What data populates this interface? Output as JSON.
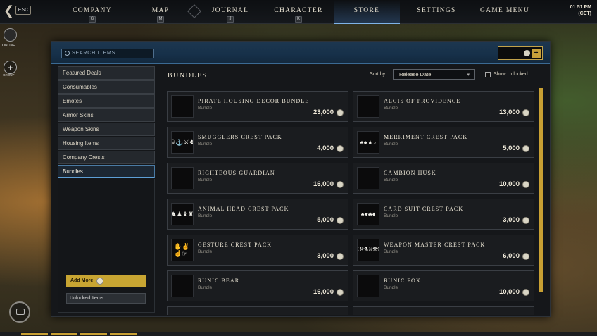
{
  "topbar": {
    "esc_label": "ESC",
    "nav": [
      {
        "label": "COMPANY",
        "key": "G"
      },
      {
        "label": "MAP",
        "key": "M"
      },
      {
        "label": "JOURNAL",
        "key": "J"
      },
      {
        "label": "CHARACTER",
        "key": "K"
      },
      {
        "label": "STORE",
        "key": ""
      },
      {
        "label": "SETTINGS",
        "key": ""
      },
      {
        "label": "GAME MENU",
        "key": ""
      }
    ],
    "clock_time": "01:51 PM",
    "clock_zone": "(CET)"
  },
  "rail": {
    "status": "ONLINE",
    "group": "GROUP"
  },
  "store": {
    "search_placeholder": "SEARCH ITEMS",
    "coin_balance": "0",
    "categories": [
      "Featured Deals",
      "Consumables",
      "Emotes",
      "Armor Skins",
      "Weapon Skins",
      "Housing Items",
      "Company Crests",
      "Bundles"
    ],
    "active_category": "Bundles",
    "add_more_label": "Add More",
    "unlocked_items_label": "Unlocked Items",
    "section_title": "BUNDLES",
    "sort_label": "Sort by :",
    "sort_value": "Release Date",
    "show_unlocked_label": "Show Unlocked",
    "items": [
      {
        "name": "PIRATE HOUSING DECOR BUNDLE",
        "type": "Bundle",
        "price": "23,000",
        "thumb": "gold-treasure-icon"
      },
      {
        "name": "AEGIS OF PROVIDENCE",
        "type": "Bundle",
        "price": "13,000",
        "thumb": "golden-helm-icon"
      },
      {
        "name": "SMUGGLERS CREST PACK",
        "type": "Bundle",
        "price": "4,000",
        "thumb": "smuggler-crests-icon"
      },
      {
        "name": "MERRIMENT CREST PACK",
        "type": "Bundle",
        "price": "5,000",
        "thumb": "merriment-crests-icon"
      },
      {
        "name": "RIGHTEOUS GUARDIAN",
        "type": "Bundle",
        "price": "16,000",
        "thumb": "steel-knight-icon"
      },
      {
        "name": "CAMBION HUSK",
        "type": "Bundle",
        "price": "10,000",
        "thumb": "horned-helm-icon"
      },
      {
        "name": "ANIMAL HEAD CREST PACK",
        "type": "Bundle",
        "price": "5,000",
        "thumb": "animal-crests-icon"
      },
      {
        "name": "CARD SUIT CREST PACK",
        "type": "Bundle",
        "price": "3,000",
        "thumb": "card-suit-crests-icon"
      },
      {
        "name": "GESTURE CREST PACK",
        "type": "Bundle",
        "price": "3,000",
        "thumb": "gesture-crests-icon"
      },
      {
        "name": "WEAPON MASTER CREST PACK",
        "type": "Bundle",
        "price": "6,000",
        "thumb": "weapon-crests-icon"
      },
      {
        "name": "RUNIC BEAR",
        "type": "Bundle",
        "price": "16,000",
        "thumb": "runic-bear-icon"
      },
      {
        "name": "RUNIC FOX",
        "type": "Bundle",
        "price": "10,000",
        "thumb": "runic-fox-icon"
      }
    ]
  },
  "colors": {
    "accent_gold": "#c8a033",
    "accent_blue": "#5d9fd6",
    "panel_bg": "#15171a"
  }
}
